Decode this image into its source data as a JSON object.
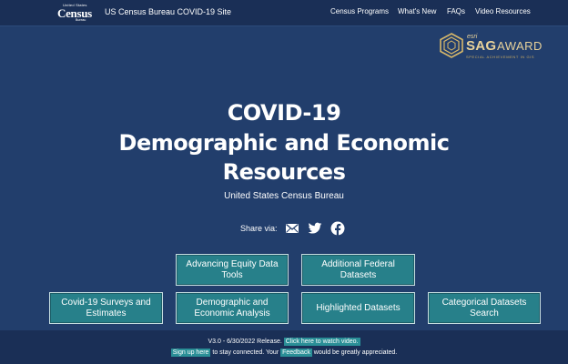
{
  "header": {
    "logo": {
      "top_text": "United States",
      "main_text": "Census",
      "bottom_text": "Bureau"
    },
    "site_title": "US Census Bureau COVID-19 Site",
    "nav": [
      {
        "label": "Census Programs"
      },
      {
        "label": "What's New"
      },
      {
        "label": "FAQs"
      },
      {
        "label": "Video Resources"
      }
    ]
  },
  "award": {
    "brand": "esri",
    "name": "SAG",
    "suffix": "AWARD",
    "subtitle": "SPECIAL ACHIEVEMENT IN GIS"
  },
  "hero": {
    "title_lines": [
      "COVID-19",
      "Demographic and Economic",
      "Resources"
    ],
    "subtitle": "United States Census Bureau"
  },
  "share": {
    "label": "Share via:",
    "icons": [
      "email-icon",
      "twitter-icon",
      "facebook-icon"
    ]
  },
  "tiles": {
    "equity": "Advancing Equity Data Tools",
    "federal": "Additional Federal Datasets",
    "surveys": "Covid-19 Surveys and Estimates",
    "demographic": "Demographic and Economic Analysis",
    "highlighted": "Highlighted Datasets",
    "categorical": "Categorical Datasets Search"
  },
  "footer": {
    "release": "V3.0 - 6/30/2022 Release.",
    "video_link": "Click here to watch video.",
    "signup_link": "Sign up here",
    "signup_text": " to stay connected. Your ",
    "feedback_link": "Feedback",
    "feedback_text": " would be greatly appreciated."
  },
  "colors": {
    "background": "#223e6c",
    "topbar": "#1a2f56",
    "tile": "#27808a",
    "award_gold": "#d8b86a"
  }
}
